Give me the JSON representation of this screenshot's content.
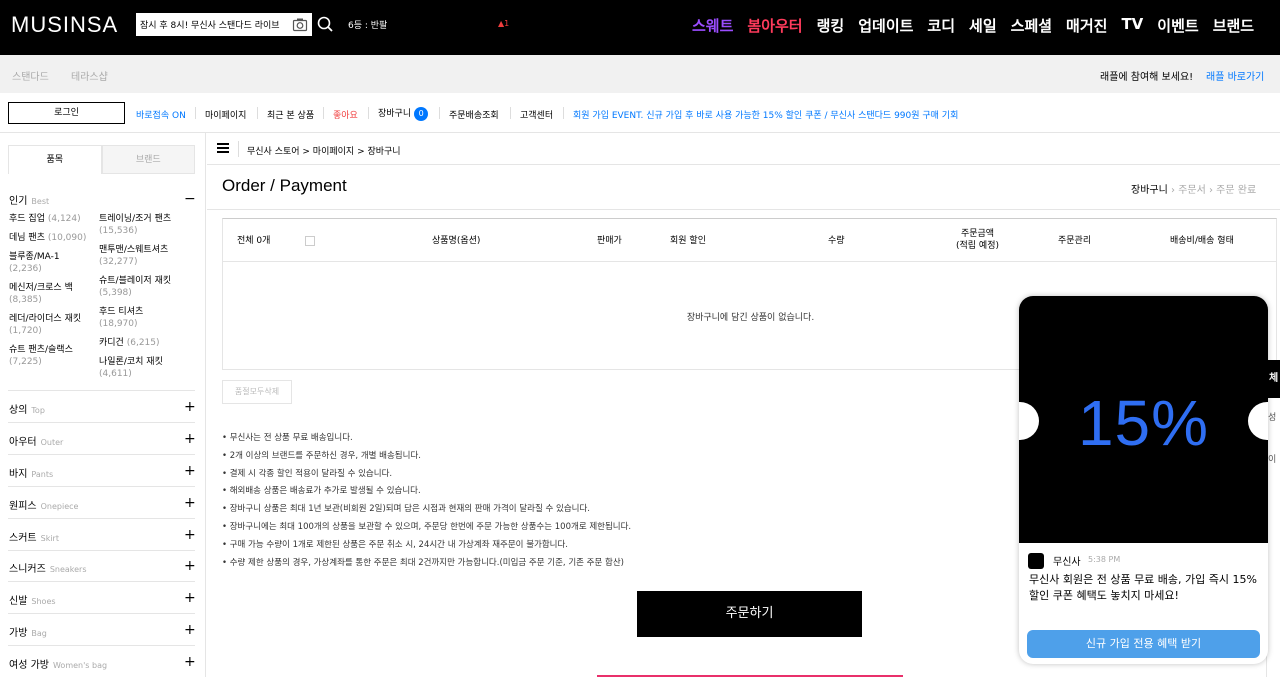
{
  "header": {
    "logo": "MUSINSA",
    "search": {
      "value": "잠시 후 8시! 무신사 스탠다드 라이브"
    },
    "rank_text": "6등 : 반팔",
    "rank_change": "▲1",
    "nav": [
      "스웨트",
      "봄아우터",
      "랭킹",
      "업데이트",
      "코디",
      "세일",
      "스페셜",
      "매거진",
      "TV",
      "이벤트",
      "브랜드"
    ],
    "nav_colors": {
      "sweat": "#9b4dff",
      "spring_outer": "#ff3b5c",
      "default": "#ffffff"
    }
  },
  "subbar": {
    "tabs": [
      "스탠다드",
      "테라스샵"
    ],
    "raffle_text": "래플에 참여해 보세요!",
    "raffle_link": "래플 바로가기"
  },
  "util": {
    "login": "로그인",
    "direct": "바로접속 ON",
    "mypage": "마이페이지",
    "recent": "최근 본 상품",
    "like": "좋아요",
    "cart": "장바구니",
    "cart_count": "0",
    "delivery": "주문배송조회",
    "cs": "고객센터",
    "promo": "회원 가입 EVENT. 신규 가입 후 바로 사용 가능한 15% 할인 쿠폰 / 무신사 스탠다드 990원 구매 기회"
  },
  "sidebar": {
    "tabs": [
      "품목",
      "브랜드"
    ],
    "popular": {
      "label": "인기",
      "en": "Best"
    },
    "categories_left": [
      {
        "name": "후드 집업",
        "count": "(4,124)"
      },
      {
        "name": "데님 팬츠",
        "count": "(10,090)"
      },
      {
        "name": "블루종/MA-1",
        "count": "(2,236)"
      },
      {
        "name": "메신저/크로스 백",
        "count": "(8,385)"
      },
      {
        "name": "레더/라이더스 재킷",
        "count": "(1,720)"
      },
      {
        "name": "슈트 팬츠/슬랙스",
        "count": "(7,225)"
      }
    ],
    "categories_right": [
      {
        "name": "트레이닝/조거 팬츠",
        "count": "(15,536)"
      },
      {
        "name": "맨투맨/스웨트셔츠",
        "count": "(32,277)"
      },
      {
        "name": "슈트/블레이저 재킷",
        "count": "(5,398)"
      },
      {
        "name": "후드 티셔츠",
        "count": "(18,970)"
      },
      {
        "name": "카디건",
        "count": "(6,215)"
      },
      {
        "name": "나일론/코치 재킷",
        "count": "(4,611)"
      }
    ],
    "sections": [
      {
        "label": "상의",
        "en": "Top"
      },
      {
        "label": "아우터",
        "en": "Outer"
      },
      {
        "label": "바지",
        "en": "Pants"
      },
      {
        "label": "원피스",
        "en": "Onepiece"
      },
      {
        "label": "스커트",
        "en": "Skirt"
      },
      {
        "label": "스니커즈",
        "en": "Sneakers"
      },
      {
        "label": "신발",
        "en": "Shoes"
      },
      {
        "label": "가방",
        "en": "Bag"
      },
      {
        "label": "여성 가방",
        "en": "Women's bag"
      }
    ]
  },
  "breadcrumb": "무신사 스토어 > 마이페이지 > 장바구니",
  "page": {
    "title": "Order / Payment",
    "steps": [
      "장바구니",
      "주문서",
      "주문 완료"
    ]
  },
  "table": {
    "total": "전체 0개",
    "columns": [
      "상품명(옵션)",
      "판매가",
      "회원 할인",
      "수량",
      "주문금액",
      "(적립 예정)",
      "주문관리",
      "배송비/배송 형태"
    ],
    "empty": "장바구니에 담긴 상품이 없습니다.",
    "delete_btn": "품절모두삭제"
  },
  "notes": [
    "무신사는 전 상품 무료 배송입니다.",
    "2개 이상의 브랜드를 주문하신 경우, 개별 배송됩니다.",
    "결제 시 각종 할인 적용이 달라질 수 있습니다.",
    "해외배송 상품은 배송료가 추가로 발생될 수 있습니다.",
    "장바구니 상품은 최대 1년 보관(비회원 2일)되며 담은 시점과 현재의 판매 가격이 달라질 수 있습니다.",
    "장바구니에는 최대 100개의 상품을 보관할 수 있으며, 주문당 한번에 주문 가능한 상품수는 100개로 제한됩니다.",
    "구매 가능 수량이 1개로 제한된 상품은 주문 취소 시, 24시간 내 가상계좌 재주문이 불가합니다.",
    "수량 제한 상품의 경우, 가상계좌를 통한 주문은 최대 2건까지만 가능합니다.(미입금 주문 기준, 기존 주문 합산)"
  ],
  "order_btn": "주문하기",
  "right_strip": {
    "top": "체",
    "items": [
      "성",
      "이"
    ]
  },
  "popup": {
    "headline": "15%",
    "sender": "무신사",
    "time": "5:38 PM",
    "message": "무신사 회원은 전 상품 무료 배송, 가입 즉시 15% 할인 쿠폰 혜택도 놓치지 마세요!",
    "cta": "신규 가입 전용 혜택 받기",
    "cta_color": "#4ea0ea",
    "accent_color": "#2f6ef2"
  }
}
